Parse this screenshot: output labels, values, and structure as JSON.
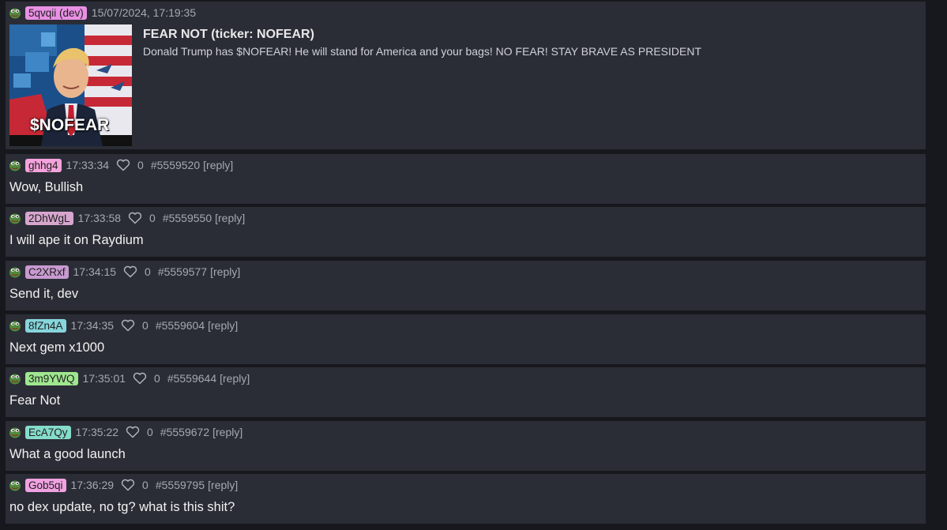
{
  "thread": {
    "op": {
      "user": "5qvqii (dev)",
      "user_color": "#e990e4",
      "timestamp": "15/07/2024, 17:19:35",
      "token_title": "FEAR NOT (ticker: NOFEAR)",
      "description": "Donald Trump has $NOFEAR! He will stand for America and your bags! NO FEAR! STAY BRAVE AS PRESIDENT",
      "image_text": "$NOFEAR"
    },
    "replies": [
      {
        "user": "ghhg4",
        "user_color": "#f5a3dc",
        "time": "17:33:34",
        "likes": "0",
        "id": "#5559520",
        "reply": "[reply]",
        "text": "Wow, Bullish"
      },
      {
        "user": "2DhWgL",
        "user_color": "#d7a6cf",
        "time": "17:33:58",
        "likes": "0",
        "id": "#5559550",
        "reply": "[reply]",
        "text": "I will ape it on Raydium"
      },
      {
        "user": "C2XRxf",
        "user_color": "#c89ad0",
        "time": "17:34:15",
        "likes": "0",
        "id": "#5559577",
        "reply": "[reply]",
        "text": "Send it, dev"
      },
      {
        "user": "8fZn4A",
        "user_color": "#86d6dc",
        "time": "17:34:35",
        "likes": "0",
        "id": "#5559604",
        "reply": "[reply]",
        "text": "Next gem x1000"
      },
      {
        "user": "3m9YWQ",
        "user_color": "#9fe78f",
        "time": "17:35:01",
        "likes": "0",
        "id": "#5559644",
        "reply": "[reply]",
        "text": "Fear Not"
      },
      {
        "user": "EcA7Qy",
        "user_color": "#86dccb",
        "time": "17:35:22",
        "likes": "0",
        "id": "#5559672",
        "reply": "[reply]",
        "text": "What a good launch"
      },
      {
        "user": "Gob5qi",
        "user_color": "#f0a2e2",
        "time": "17:36:29",
        "likes": "0",
        "id": "#5559795",
        "reply": "[reply]",
        "text": "no dex update, no tg? what is this shit?"
      }
    ]
  }
}
